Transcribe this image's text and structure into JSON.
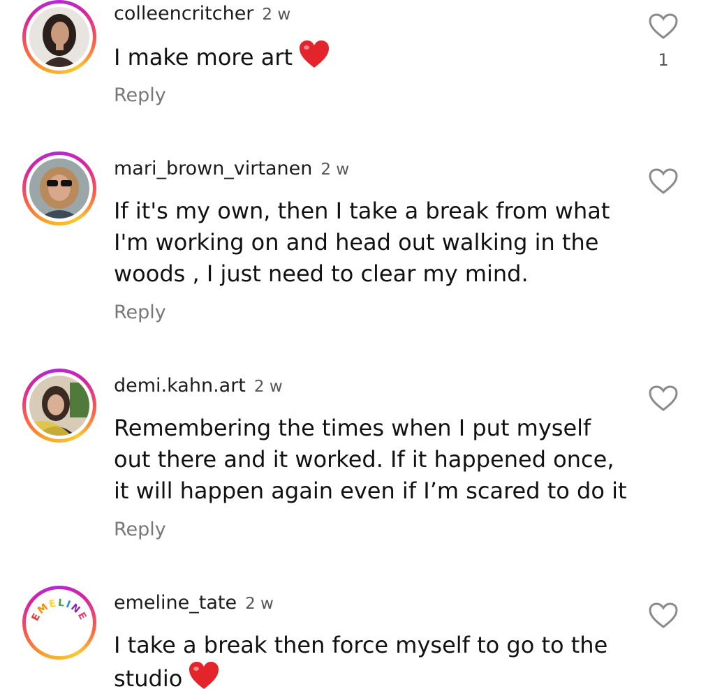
{
  "comments": [
    {
      "username": "colleencritcher",
      "time": "2 w",
      "text": "I make more art",
      "emoji": "red-heart",
      "reply_label": "Reply",
      "likes": "1",
      "avatar": "woman-dark-hair-photo"
    },
    {
      "username": "mari_brown_virtanen",
      "time": "2 w",
      "text": "If it's my own, then I take a break from what I'm working on and head out walking in the woods , I just need to clear my mind.",
      "reply_label": "Reply",
      "avatar": "woman-sunglasses-photo"
    },
    {
      "username": "demi.kahn.art",
      "time": "2 w",
      "text": "Remembering the times when I put myself out there and it worked. If it happened once, it will happen again even if I’m scared to do it",
      "reply_label": "Reply",
      "avatar": "woman-indoor-photo"
    },
    {
      "username": "emeline_tate",
      "time": "2 w",
      "text": "I take a break then force myself to go to the studio",
      "emoji": "red-heart",
      "avatar_text": "EMELINE",
      "avatar": "emeline-logo"
    }
  ],
  "colors": {
    "ring_start": "#f9a825",
    "ring_mid": "#d6249f",
    "ring_end": "#b02bd8",
    "heart_red": "#e3242b",
    "reply_gray": "#777777"
  }
}
